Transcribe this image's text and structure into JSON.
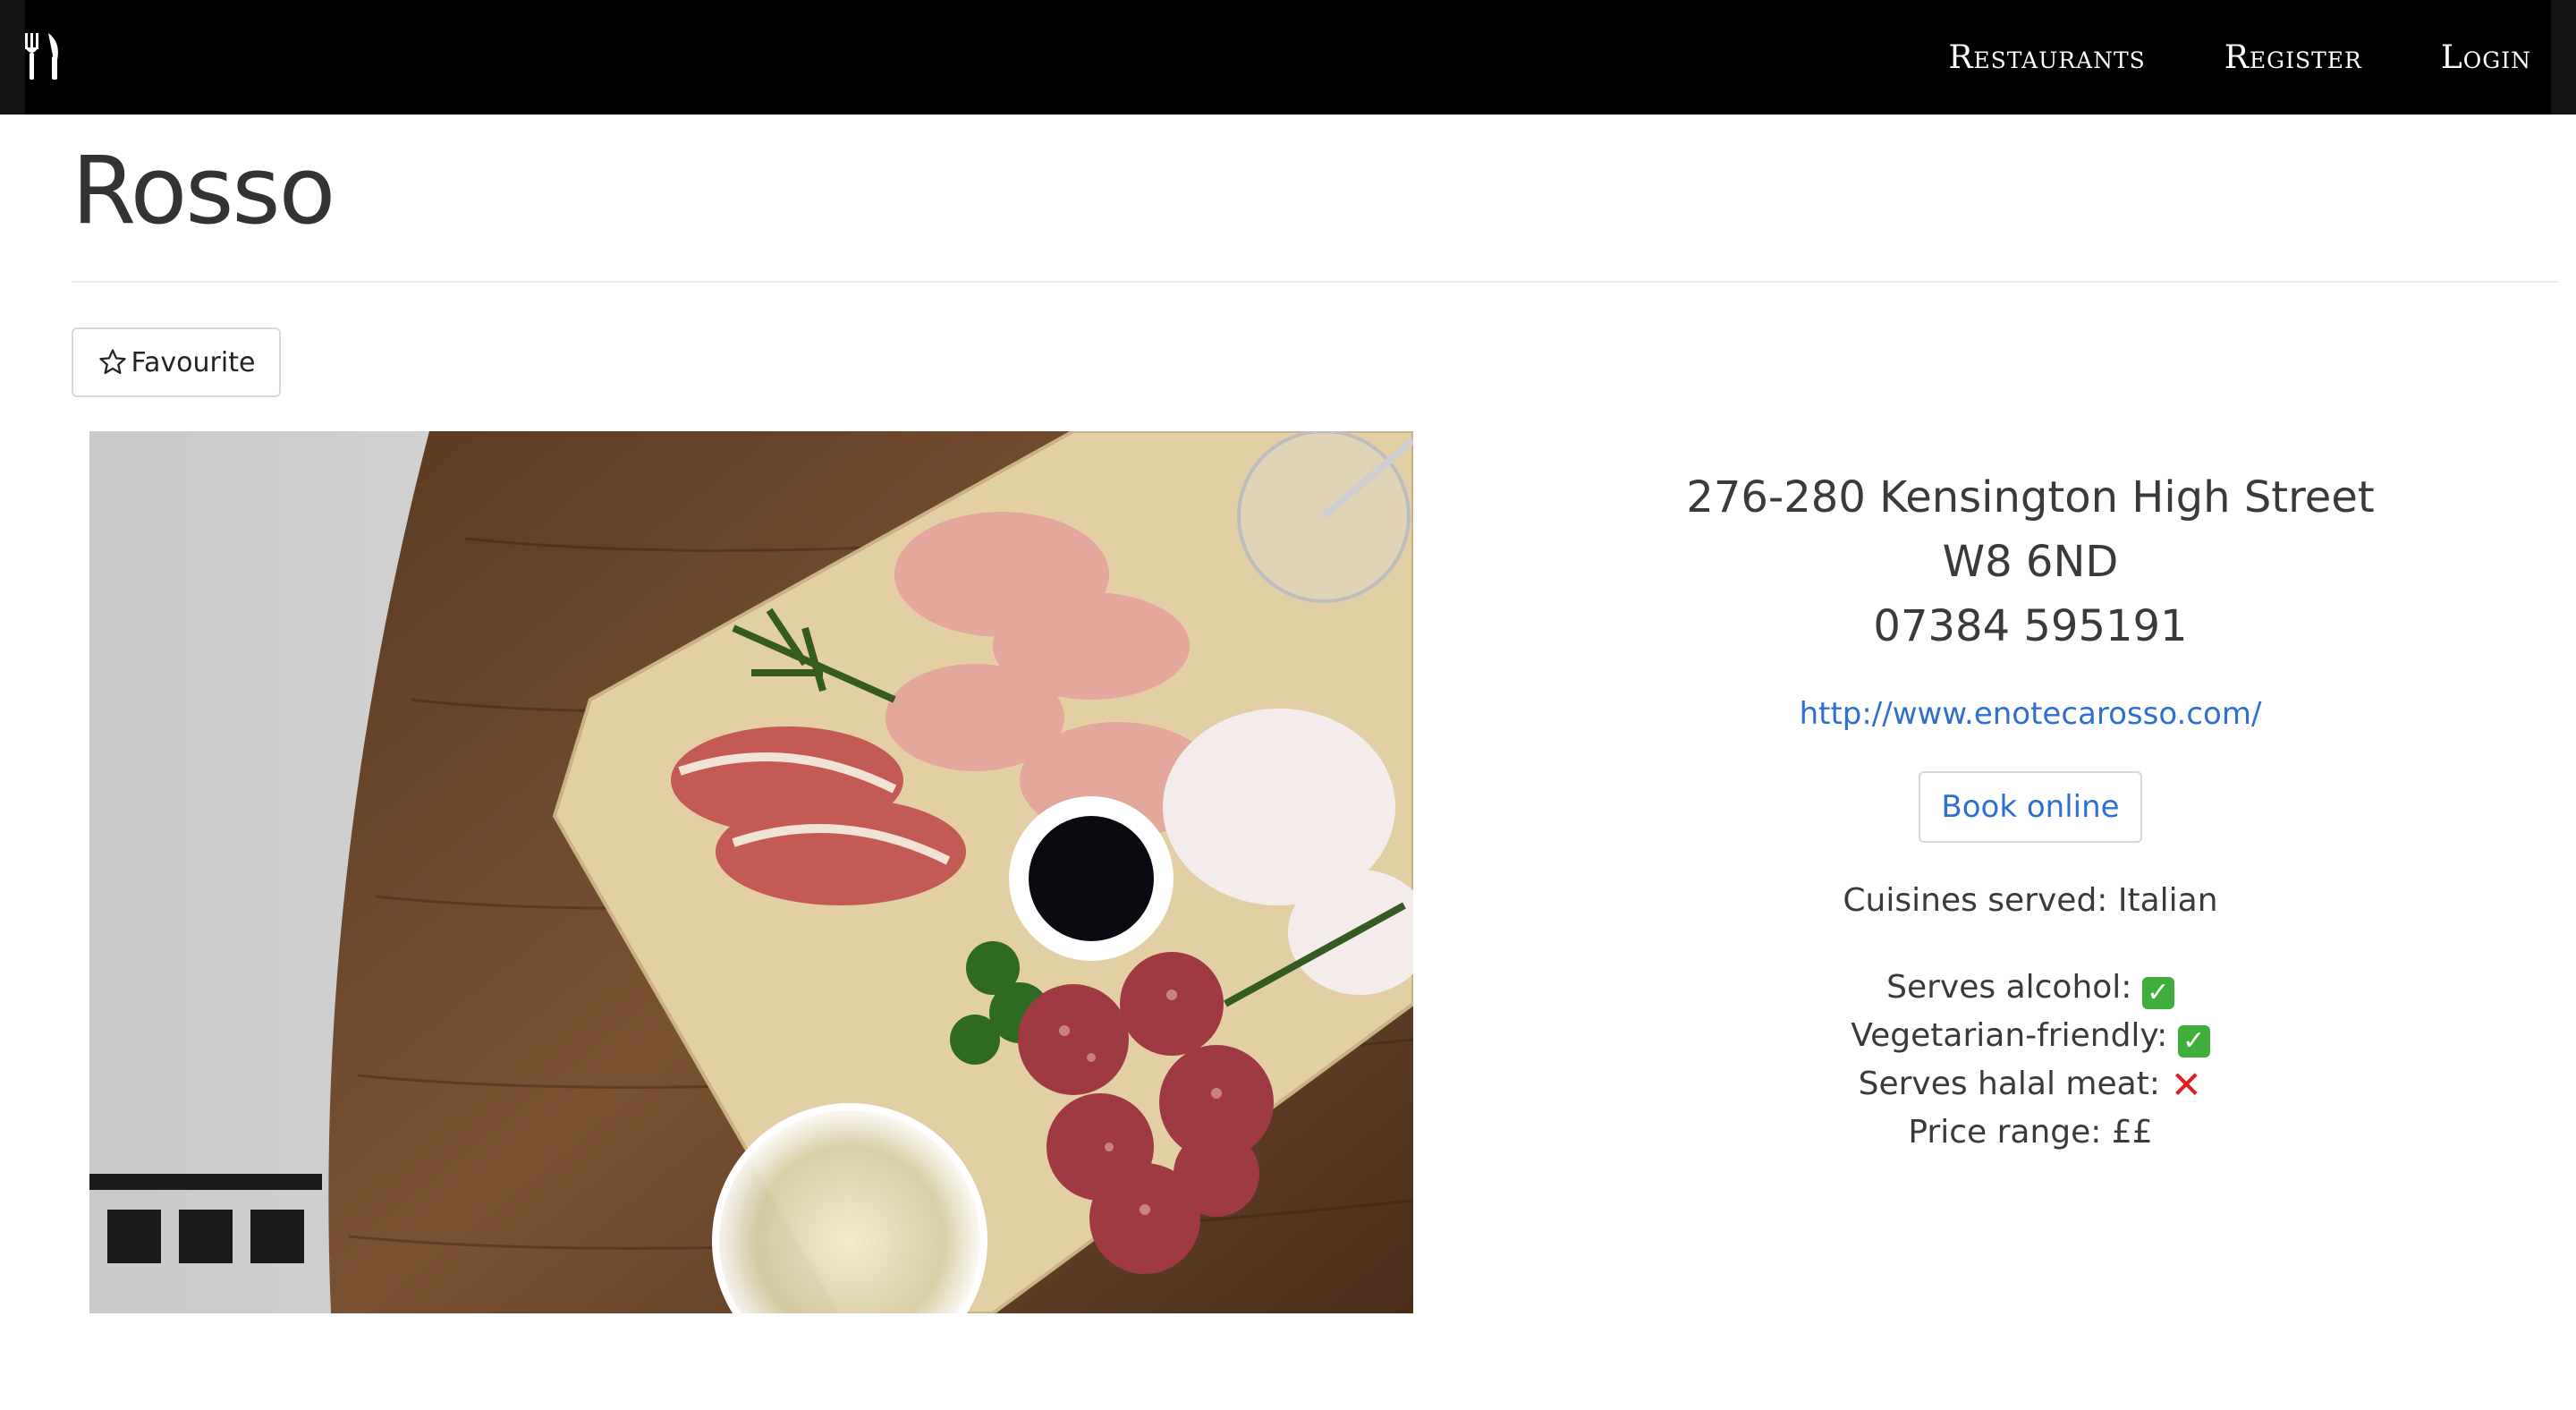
{
  "nav": {
    "brand_icon": "utensils-icon",
    "links": [
      "Restaurants",
      "Register",
      "Login"
    ]
  },
  "restaurant": {
    "name": "Rosso",
    "favourite_label": "Favourite",
    "image_alt": "charcuterie-board-photo",
    "address": [
      "276-280 Kensington High Street",
      "W8 6ND",
      "07384 595191"
    ],
    "website": "http://www.enotecarosso.com/",
    "book_label": "Book online",
    "cuisines": "Cuisines served: Italian",
    "facts": {
      "alcohol_label": "Serves alcohol:",
      "alcohol_value": "✅",
      "vegetarian_label": "Vegetarian-friendly:",
      "vegetarian_value": "✅",
      "halal_label": "Serves halal meat:",
      "halal_value": "❌",
      "price": "Price range: ££"
    }
  },
  "colors": {
    "navbar": "#000000",
    "link": "#2f6fd0",
    "yes": "#3fae3a",
    "no": "#e02020"
  }
}
